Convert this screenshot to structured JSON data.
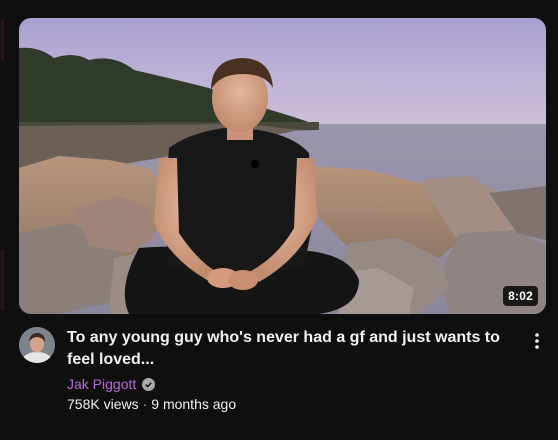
{
  "video": {
    "duration": "8:02",
    "title": "To any young guy who's never had a gf and just wants to feel loved...",
    "channel": {
      "name": "Jak Piggott",
      "verified": true
    },
    "views": "758K views",
    "separator": "·",
    "age": "9 months ago"
  },
  "icons": {
    "verified": "verified-check-icon",
    "menu": "three-dot-vertical-icon"
  },
  "colors": {
    "background": "#0f0f0f",
    "title": "#f1f1f1",
    "channel_name": "#b46ad8",
    "secondary": "#aaaaaa"
  }
}
